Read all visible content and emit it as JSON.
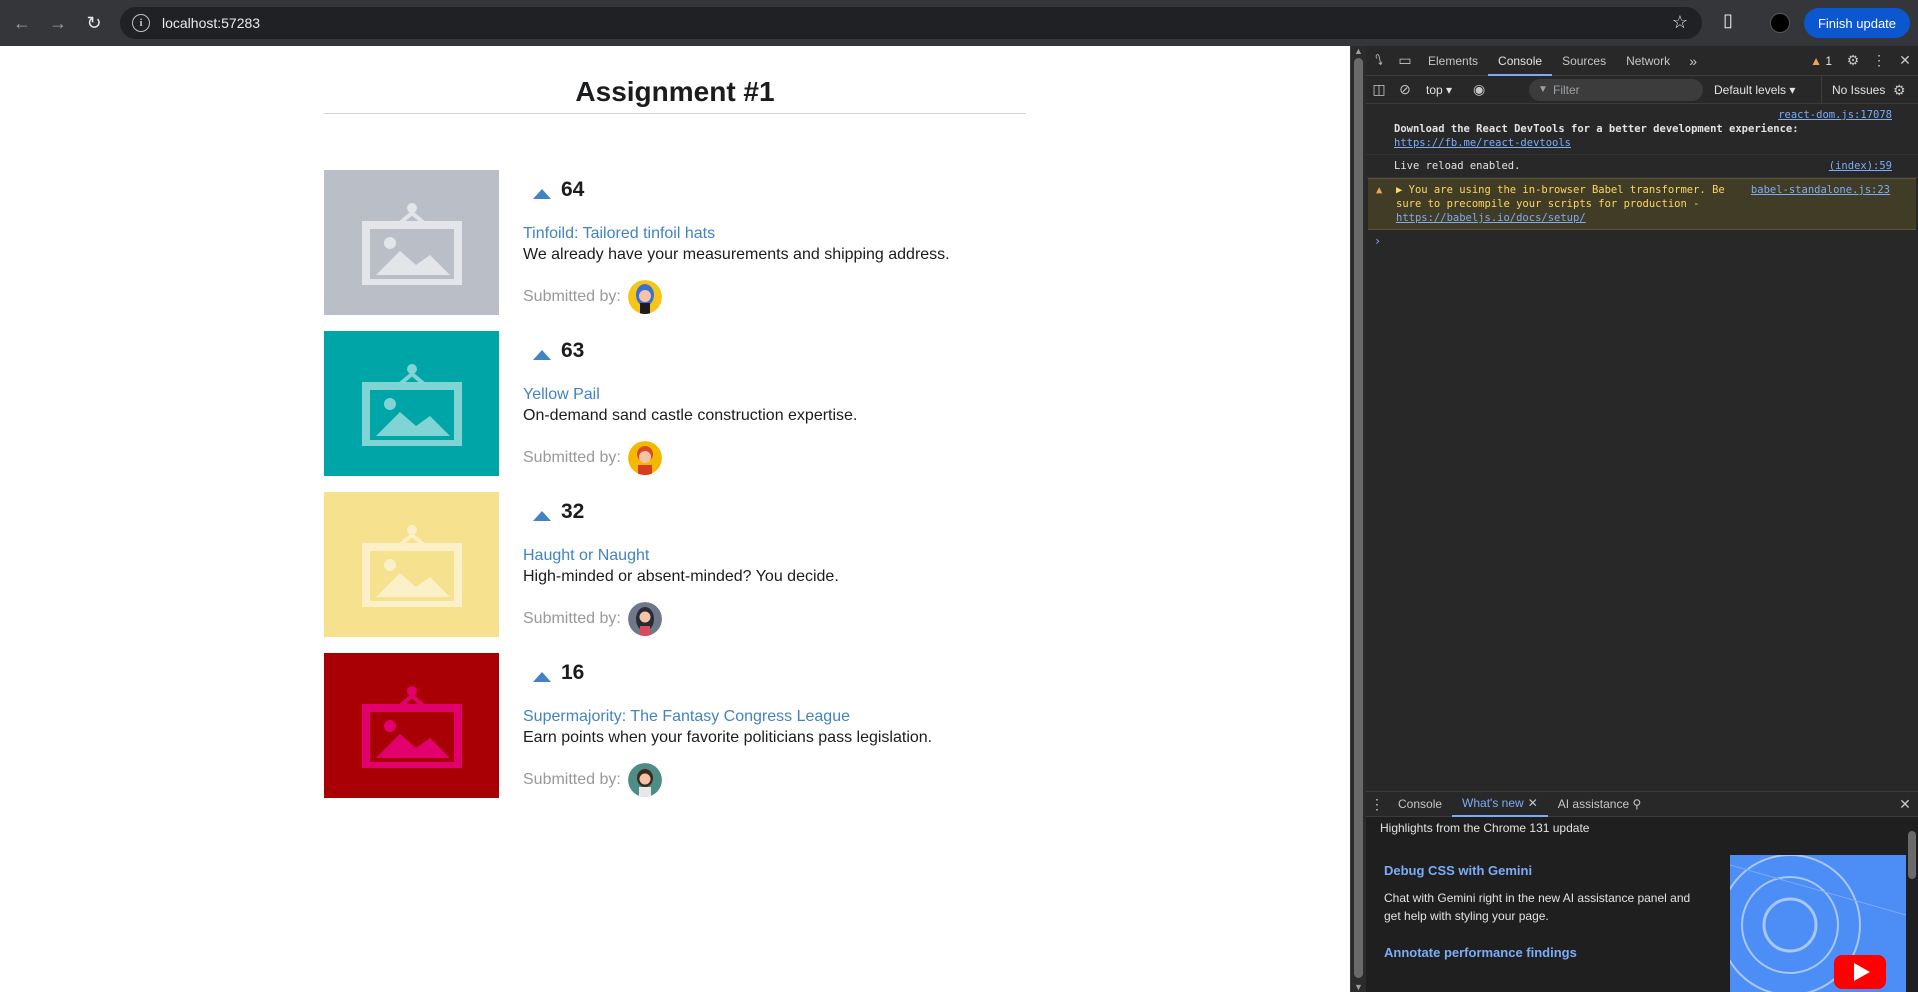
{
  "browser": {
    "url": "localhost:57283",
    "update_label": "Finish update"
  },
  "page": {
    "title": "Assignment #1",
    "submitted_label": "Submitted by:",
    "products": [
      {
        "votes": "64",
        "title": "Tinfoild: Tailored tinfoil hats",
        "description": "We already have your measurements and shipping address.",
        "thumb_color": "#babfc7",
        "icon_color": "#e3e5e8",
        "avatar": "woman-blue-hair-avatar"
      },
      {
        "votes": "63",
        "title": "Yellow Pail",
        "description": "On-demand sand castle construction expertise.",
        "thumb_color": "#00a5a8",
        "icon_color": "#80d4d3",
        "avatar": "man-red-hair-avatar"
      },
      {
        "votes": "32",
        "title": "Haught or Naught",
        "description": "High-minded or absent-minded? You decide.",
        "thumb_color": "#f6e18e",
        "icon_color": "#fbf0c7",
        "avatar": "woman-dark-hair-avatar"
      },
      {
        "votes": "16",
        "title": "Supermajority: The Fantasy Congress League",
        "description": "Earn points when your favorite politicians pass legislation.",
        "thumb_color": "#a90005",
        "icon_color": "#e2006c",
        "avatar": "woman-teal-background-avatar"
      }
    ]
  },
  "devtools": {
    "tabs": [
      "Elements",
      "Console",
      "Sources",
      "Network"
    ],
    "active_tab": "Console",
    "warning_count": "1",
    "context": "top",
    "filter_placeholder": "Filter",
    "levels": "Default levels",
    "issues": "No Issues",
    "messages": [
      {
        "source": "react-dom.js:17078",
        "text": "Download the React DevTools for a better development experience:",
        "link": "https://fb.me/react-devtools"
      },
      {
        "source": "(index):59",
        "text": "Live reload enabled."
      },
      {
        "source": "babel-standalone.js:23",
        "text": "▶ You are using the in-browser Babel transformer. Be sure to precompile your scripts for production -",
        "link": "https://babeljs.io/docs/setup/"
      }
    ],
    "drawer": {
      "tabs": [
        "Console",
        "What's new",
        "AI assistance"
      ],
      "active_tab": "What's new",
      "highlights": "Highlights from the Chrome 131 update",
      "feature1_title": "Debug CSS with Gemini",
      "feature1_desc": "Chat with Gemini right in the new AI assistance panel and get help with styling your page.",
      "feature2_title": "Annotate performance findings"
    }
  }
}
